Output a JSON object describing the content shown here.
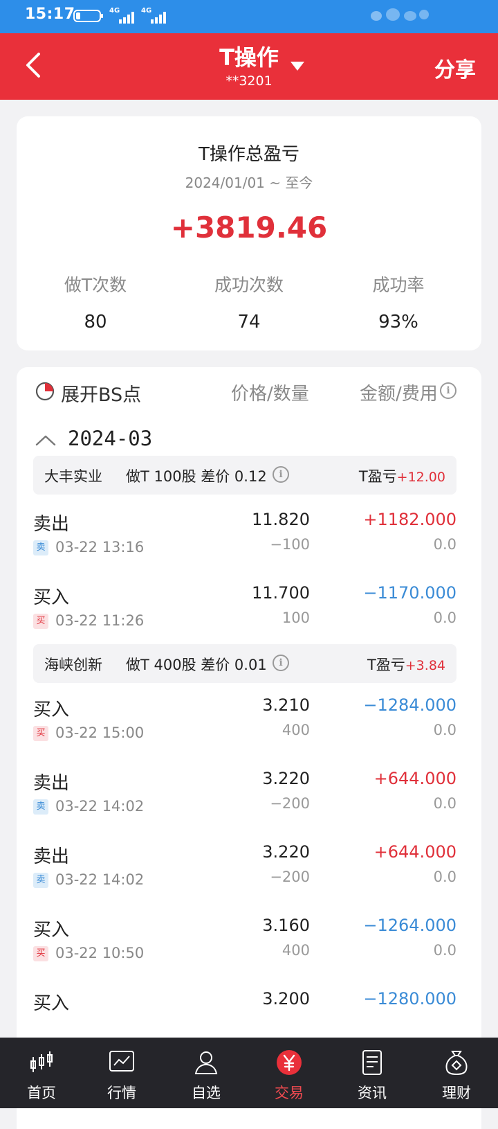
{
  "status_bar": {
    "time": "15:17",
    "net1": "4G",
    "net2": "4G"
  },
  "header": {
    "title": "T操作",
    "account": "**3201",
    "share_label": "分享"
  },
  "summary": {
    "title": "T操作总盈亏",
    "range": "2024/01/01 ~ 至今",
    "total": "+3819.46",
    "stats": [
      {
        "label": "做T次数",
        "value": "80"
      },
      {
        "label": "成功次数",
        "value": "74"
      },
      {
        "label": "成功率",
        "value": "93%"
      }
    ]
  },
  "detail": {
    "expand_label": "展开BS点",
    "col_price_qty": "价格/数量",
    "col_amount_fee": "金额/费用",
    "month": "2024-03",
    "groups": [
      {
        "name": "大丰实业",
        "desc": "做T 100股 差价 0.12",
        "pnl_label": "T盈亏",
        "pnl_value": "+12.00",
        "trades": [
          {
            "side": "卖出",
            "tag": "卖",
            "time": "03-22 13:16",
            "price": "11.820",
            "qty": "−100",
            "amount": "+1182.000",
            "fee": "0.0"
          },
          {
            "side": "买入",
            "tag": "买",
            "time": "03-22 11:26",
            "price": "11.700",
            "qty": "100",
            "amount": "−1170.000",
            "fee": "0.0"
          }
        ]
      },
      {
        "name": "海峡创新",
        "desc": "做T 400股 差价 0.01",
        "pnl_label": "T盈亏",
        "pnl_value": "+3.84",
        "trades": [
          {
            "side": "买入",
            "tag": "买",
            "time": "03-22 15:00",
            "price": "3.210",
            "qty": "400",
            "amount": "−1284.000",
            "fee": "0.0"
          },
          {
            "side": "卖出",
            "tag": "卖",
            "time": "03-22 14:02",
            "price": "3.220",
            "qty": "−200",
            "amount": "+644.000",
            "fee": "0.0"
          },
          {
            "side": "卖出",
            "tag": "卖",
            "time": "03-22 14:02",
            "price": "3.220",
            "qty": "−200",
            "amount": "+644.000",
            "fee": "0.0"
          },
          {
            "side": "买入",
            "tag": "买",
            "time": "03-22 10:50",
            "price": "3.160",
            "qty": "400",
            "amount": "−1264.000",
            "fee": "0.0"
          },
          {
            "side": "买入",
            "tag": "买",
            "time": "",
            "price": "3.200",
            "qty": "",
            "amount": "−1280.000",
            "fee": ""
          }
        ]
      }
    ]
  },
  "tabbar": {
    "items": [
      {
        "label": "首页",
        "icon": "candlestick-icon"
      },
      {
        "label": "行情",
        "icon": "chart-line-icon"
      },
      {
        "label": "自选",
        "icon": "person-icon"
      },
      {
        "label": "交易",
        "icon": "yen-coin-icon",
        "active": true
      },
      {
        "label": "资讯",
        "icon": "document-icon"
      },
      {
        "label": "理财",
        "icon": "money-bag-icon"
      }
    ]
  },
  "colors": {
    "header_red": "#e9303a",
    "status_blue": "#2d8ee9",
    "gain_red": "#e0303a",
    "loss_blue": "#3a8bd6",
    "tabbar_bg": "#25252a"
  }
}
